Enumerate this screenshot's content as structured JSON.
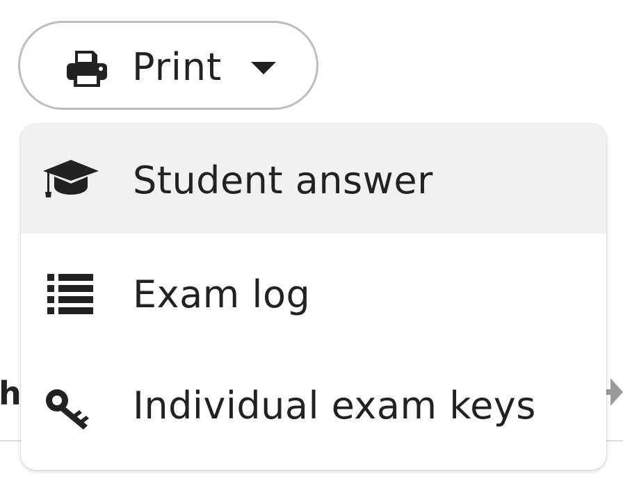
{
  "print_button": {
    "label": "Print",
    "icon": "printer-icon",
    "caret_icon": "caret-down-icon"
  },
  "menu": {
    "items": [
      {
        "label": "Student answer",
        "icon": "graduation-cap-icon",
        "highlighted": true
      },
      {
        "label": "Exam log",
        "icon": "list-icon",
        "highlighted": false
      },
      {
        "label": "Individual exam keys",
        "icon": "key-icon",
        "highlighted": false
      }
    ]
  },
  "background": {
    "partial_text": "h"
  },
  "colors": {
    "text": "#222222",
    "button_border": "#bdbdbd",
    "highlight": "#f1f1f1",
    "menu_background": "#ffffff"
  }
}
